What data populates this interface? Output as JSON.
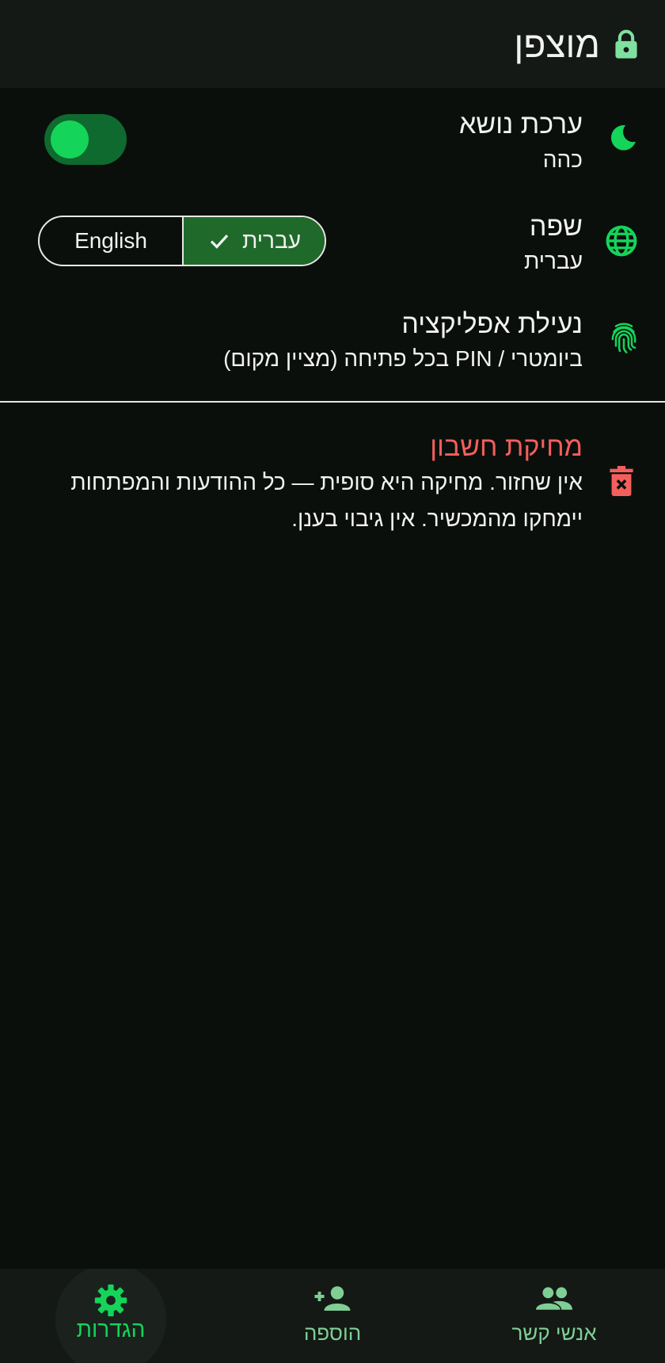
{
  "header": {
    "title": "מוצפן",
    "icon": "lock-icon"
  },
  "theme": {
    "title": "ערכת נושא",
    "subtitle": "כהה",
    "icon": "moon-icon",
    "toggle_on": true
  },
  "language": {
    "title": "שפה",
    "subtitle": "עברית",
    "icon": "globe-icon",
    "options": [
      "English",
      "עברית"
    ],
    "selected": "עברית"
  },
  "app_lock": {
    "title": "נעילת אפליקציה",
    "subtitle": "ביומטרי / PIN בכל פתיחה (מציין מקום)",
    "icon": "fingerprint-icon"
  },
  "delete_account": {
    "title": "מחיקת חשבון",
    "body": "אין שחזור. מחיקה היא סופית — כל ההודעות והמפתחות יימחקו מהמכשיר. אין גיבוי בענן.",
    "icon": "trash-icon"
  },
  "bottom_nav": {
    "items": [
      {
        "label": "אנשי קשר",
        "icon": "contacts-icon"
      },
      {
        "label": "הוספה",
        "icon": "add-person-icon"
      },
      {
        "label": "הגדרות",
        "icon": "settings-gear-icon",
        "active": true
      }
    ]
  },
  "colors": {
    "accent": "#14d45a",
    "danger": "#f25f5c",
    "background": "#0b0f0c",
    "bar": "#141915"
  }
}
